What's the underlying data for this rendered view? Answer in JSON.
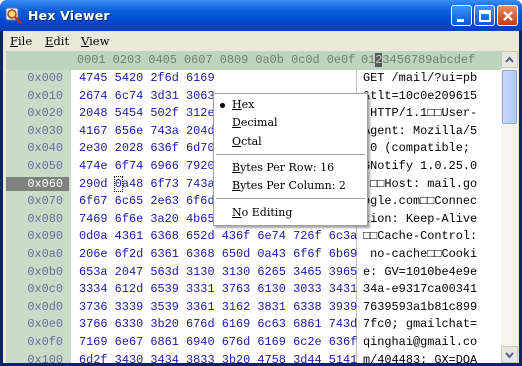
{
  "window": {
    "title": "Hex Viewer",
    "icon": "magnifier-app-icon"
  },
  "menubar": {
    "items": [
      {
        "pre": "",
        "ul": "F",
        "post": "ile"
      },
      {
        "pre": "",
        "ul": "E",
        "post": "dit"
      },
      {
        "pre": "",
        "ul": "V",
        "post": "iew"
      }
    ]
  },
  "header": {
    "hex": "0001 0203 0405 0607 0809 0a0b 0c0d 0e0f",
    "ascii_pre": "01",
    "ascii_hi": "2",
    "ascii_post": "3456789abcdef"
  },
  "rows": [
    {
      "addr": "0x000",
      "hex": "4745 5420 2f6d 6169",
      "ascii": "GET /mail/?ui=pb"
    },
    {
      "addr": "0x010",
      "hex": "2674 6c74 3d31 3063",
      "ascii": "&tlt=10c0e209615"
    },
    {
      "addr": "0x020",
      "hex": "2048 5454 502f 312e",
      "ascii": " HTTP/1.1□□User-"
    },
    {
      "addr": "0x030",
      "hex": "4167 656e 743a 204d",
      "ascii": "Agent: Mozilla/5"
    },
    {
      "addr": "0x040",
      "hex": "2e30 2028 636f 6d70",
      "ascii": ".0 (compatible;"
    },
    {
      "addr": "0x050",
      "hex": "474e 6f74 6966 7920",
      "ascii": "GNotify 1.0.25.0"
    },
    {
      "addr": "0x060",
      "hex": "290d 0a48 6f73 743a",
      "ascii": ")□□Host: mail.go"
    },
    {
      "addr": "0x070",
      "hex": "6f67 6c65 2e63 6f6d 0d0a 436f 6e6e 6563",
      "ascii": "ogle.com□□Connec"
    },
    {
      "addr": "0x080",
      "hex": "7469 6f6e 3a20 4b65 6570 2d41 6c69 7665",
      "ascii": "tion: Keep-Alive"
    },
    {
      "addr": "0x090",
      "hex": "0d0a 4361 6368 652d 436f 6e74 726f 6c3a",
      "ascii": "□□Cache-Control:"
    },
    {
      "addr": "0x0a0",
      "hex": "206e 6f2d 6361 6368 650d 0a43 6f6f 6b69",
      "ascii": " no-cache□□Cooki"
    },
    {
      "addr": "0x0b0",
      "hex": "653a 2047 563d 3130 3130 6265 3465 3965",
      "ascii": "e: GV=1010be4e9e"
    },
    {
      "addr": "0x0c0",
      "hex": "3334 612d 6539 3331 3763 6130 3033 3431",
      "ascii": "34a-e9317ca00341"
    },
    {
      "addr": "0x0d0",
      "hex": "3736 3339 3539 3361 3162 3831 6338 3939",
      "ascii": "7639593a1b81c899"
    },
    {
      "addr": "0x0e0",
      "hex": "3766 6330 3b20 676d 6169 6c63 6861 743d",
      "ascii": "7fc0; gmailchat="
    },
    {
      "addr": "0x0f0",
      "hex": "7169 6e67 6861 6940 676d 6169 6c2e 636f",
      "ascii": "qinghai@gmail.co"
    },
    {
      "addr": "0x100",
      "hex": "6d2f 3430 3434 3833 3b20 4758 3d44 5141",
      "ascii": "m/404483; GX=DQA"
    }
  ],
  "selected_row": "0x060",
  "context_menu": {
    "items": [
      {
        "ul": "H",
        "post": "ex",
        "checked": true
      },
      {
        "ul": "D",
        "post": "ecimal"
      },
      {
        "ul": "O",
        "post": "ctal"
      },
      {
        "ul": "B",
        "post": "ytes Per Row: 16"
      },
      {
        "ul": "B",
        "post": "ytes Per Column: 2"
      },
      {
        "ul": "N",
        "post": "o Editing"
      }
    ]
  },
  "colors": {
    "titlebar": "#0a5fd8",
    "address_bg": "#c8dcc8",
    "hex_text": "#1a1aa8",
    "header_bg": "#bdd5bd"
  }
}
